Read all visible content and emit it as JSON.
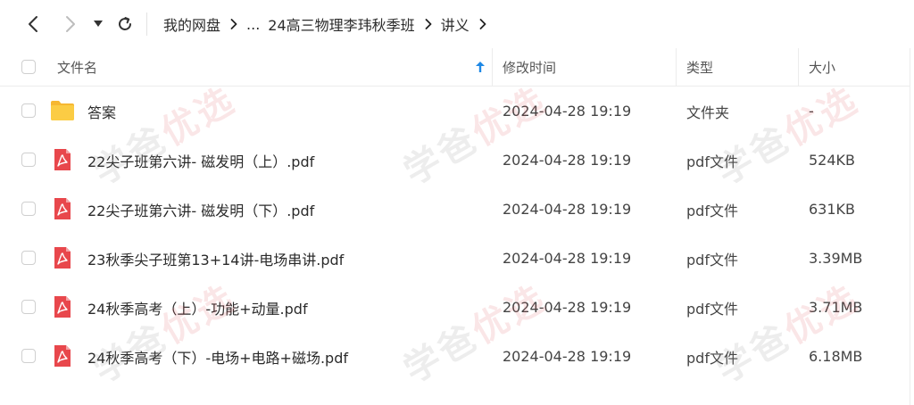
{
  "toolbar": {
    "back_icon": "chevron-left-icon",
    "forward_icon": "chevron-right-icon",
    "history_icon": "caret-down-icon",
    "refresh_icon": "refresh-icon"
  },
  "breadcrumb": {
    "root": "我的网盘",
    "ellipsis": "...",
    "folder": "24高三物理李玮秋季班",
    "current": "讲义"
  },
  "columns": {
    "name": "文件名",
    "modified": "修改时间",
    "type": "类型",
    "size": "大小",
    "sort_icon": "arrow-up-icon"
  },
  "files": [
    {
      "name": "答案",
      "modified": "2024-04-28 19:19",
      "type": "文件夹",
      "size": "-",
      "icon": "folder-icon"
    },
    {
      "name": "22尖子班第六讲- 磁发明（上）.pdf",
      "modified": "2024-04-28 19:19",
      "type": "pdf文件",
      "size": "524KB",
      "icon": "pdf-icon"
    },
    {
      "name": "22尖子班第六讲- 磁发明（下）.pdf",
      "modified": "2024-04-28 19:19",
      "type": "pdf文件",
      "size": "631KB",
      "icon": "pdf-icon"
    },
    {
      "name": "23秋季尖子班第13+14讲-电场串讲.pdf",
      "modified": "2024-04-28 19:19",
      "type": "pdf文件",
      "size": "3.39MB",
      "icon": "pdf-icon"
    },
    {
      "name": "24秋季高考（上）-功能+动量.pdf",
      "modified": "2024-04-28 19:19",
      "type": "pdf文件",
      "size": "3.71MB",
      "icon": "pdf-icon"
    },
    {
      "name": "24秋季高考（下）-电场+电路+磁场.pdf",
      "modified": "2024-04-28 19:19",
      "type": "pdf文件",
      "size": "6.18MB",
      "icon": "pdf-icon"
    }
  ],
  "watermark": {
    "part1": "学爸",
    "part2": "优选"
  },
  "colors": {
    "pdf_red": "#e8474c",
    "folder_yellow": "#f9c33c",
    "accent_blue": "#1e88e5",
    "watermark_red": "#e0444c"
  }
}
